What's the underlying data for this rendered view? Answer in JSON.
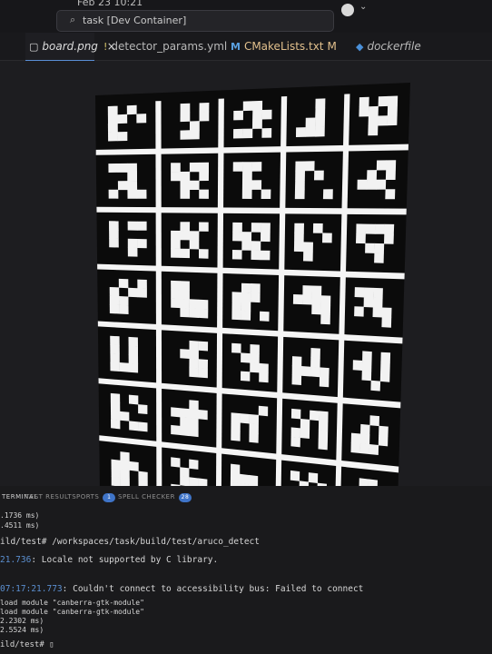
{
  "titlebar": {
    "date": "Feb 23  10:21",
    "command_center_label": "task [Dev Container]"
  },
  "tabs": [
    {
      "label": "board.png",
      "icon": "image-icon",
      "close": "×",
      "active": true
    },
    {
      "label": "detector_params.yml",
      "icon": "!",
      "active": false
    },
    {
      "label": "CMakeLists.txt",
      "icon": "M",
      "badge": "M",
      "active": false
    },
    {
      "label": "dockerfile",
      "icon": "docker-icon",
      "active": false
    }
  ],
  "board": {
    "rows": 7,
    "cols": 5,
    "description_colors": {
      "background": "#0b0b0b",
      "marker_white": "#f2f2f2",
      "margin": "#f5f5f5"
    },
    "markers": [
      [
        "1010110110001100",
        "0101010100100110",
        "0110101100101101",
        "0010001001101110",
        "1011110101110100"
      ],
      [
        "1110001001101011",
        "1011110101100101",
        "1110010001100101",
        "1100101010001001",
        "0011010111100001"
      ],
      [
        "1011100010110010",
        "0101111010101101",
        "1011110101101011",
        "1010100111000100",
        "1111100101100010"
      ],
      [
        "0101101111001100",
        "1100110011110111",
        "0110111011001101",
        "0110111100110001",
        "1110011010110001"
      ],
      [
        "1010101010101110",
        "0011011000110011",
        "1010011000110101",
        "0010101011111001",
        "0101110101010010"
      ],
      [
        "1010100111001011",
        "0010111101101110",
        "0001111010101010",
        "1011010111011001",
        "0010010111011110"
      ],
      [
        "0100111011011101",
        "1010010001111010",
        "1000111011101011",
        "1010010111010100",
        "0110111010011110"
      ]
    ]
  },
  "panel": {
    "tabs": [
      {
        "label": "TERMINAL",
        "active": true
      },
      {
        "label": "TEST RESULTS",
        "active": false
      },
      {
        "label": "PORTS",
        "badge": "1",
        "active": false
      },
      {
        "label": "SPELL CHECKER",
        "badge": "28",
        "active": false
      }
    ],
    "terminal_lines": [
      {
        "text": ".1736 ms)"
      },
      {
        "text": ".4511 ms)"
      },
      {
        "text": "ild/test# /workspaces/task/build/test/aruco_detect"
      },
      {
        "ts": "21.736",
        "text": "Locale not supported by C library."
      },
      {
        "ts": "07:17:21.773",
        "text": "Couldn't connect to accessibility bus: Failed to connect"
      },
      {
        "text": "load module \"canberra-gtk-module\""
      },
      {
        "text": "load module \"canberra-gtk-module\""
      },
      {
        "text": "2.2302 ms)"
      },
      {
        "text": "2.5524 ms)"
      },
      {
        "text": "ild/test# ▯"
      }
    ]
  }
}
